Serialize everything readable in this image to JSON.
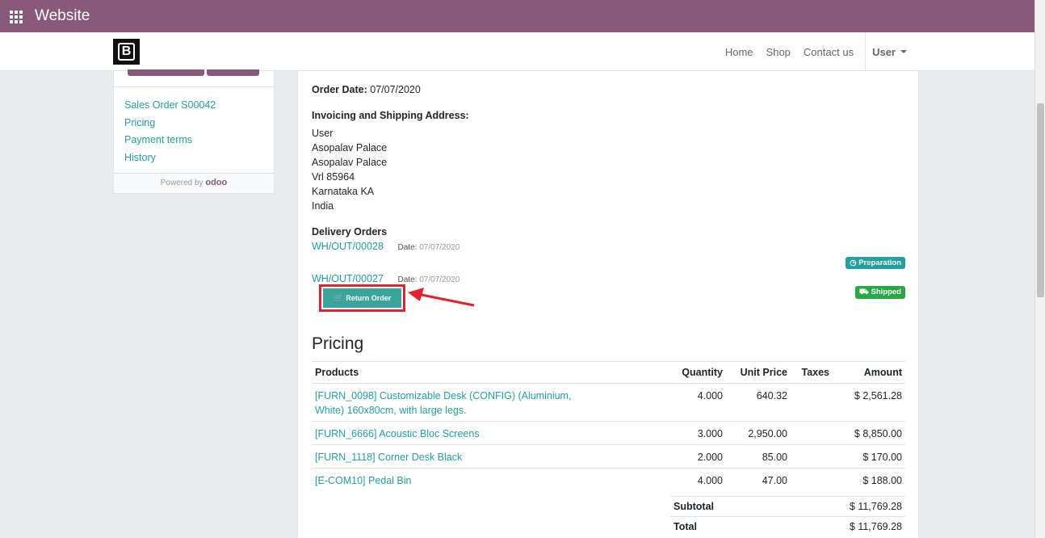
{
  "app": {
    "title": "Website"
  },
  "navbar": {
    "logo_text": "B",
    "links": [
      "Home",
      "Shop",
      "Contact us"
    ],
    "user_label": "User"
  },
  "sidebar": {
    "links": [
      "Sales Order S00042",
      "Pricing",
      "Payment terms",
      "History"
    ],
    "powered_by": "Powered by",
    "powered_brand": "odoo"
  },
  "order": {
    "date_label": "Order Date:",
    "date_value": "07/07/2020",
    "address_heading": "Invoicing and Shipping Address:",
    "address_lines": [
      "User",
      "Asopalav Palace",
      "Asopalav Palace",
      "Vrl 85964",
      "Karnataka KA",
      "India"
    ],
    "delivery_heading": "Delivery Orders",
    "deliveries": [
      {
        "ref": "WH/OUT/00028",
        "date_label": "Date:",
        "date": "07/07/2020",
        "status": "Preparation"
      },
      {
        "ref": "WH/OUT/00027",
        "date_label": "Date:",
        "date": "07/07/2020",
        "status": "Shipped"
      }
    ],
    "return_button": "Return Order"
  },
  "pricing": {
    "heading": "Pricing",
    "columns": [
      "Products",
      "Quantity",
      "Unit Price",
      "Taxes",
      "Amount"
    ],
    "rows": [
      {
        "product": "[FURN_0098] Customizable Desk (CONFIG) (Aluminium, White) 160x80cm, with large legs.",
        "qty": "4.000",
        "price": "640.32",
        "taxes": "",
        "amount": "$ 2,561.28"
      },
      {
        "product": "[FURN_6666] Acoustic Bloc Screens",
        "qty": "3.000",
        "price": "2,950.00",
        "taxes": "",
        "amount": "$ 8,850.00"
      },
      {
        "product": "[FURN_1118] Corner Desk Black",
        "qty": "2.000",
        "price": "85.00",
        "taxes": "",
        "amount": "$ 170.00"
      },
      {
        "product": "[E-COM10] Pedal Bin",
        "qty": "4.000",
        "price": "47.00",
        "taxes": "",
        "amount": "$ 188.00"
      }
    ],
    "subtotal_label": "Subtotal",
    "subtotal": "$ 11,769.28",
    "total_label": "Total",
    "total": "$ 11,769.28"
  },
  "colors": {
    "brand": "#875a7b",
    "link": "#21a0a0",
    "preparation_badge": "#21a0a0",
    "shipped_badge": "#28a745",
    "highlight": "#e3222f"
  }
}
